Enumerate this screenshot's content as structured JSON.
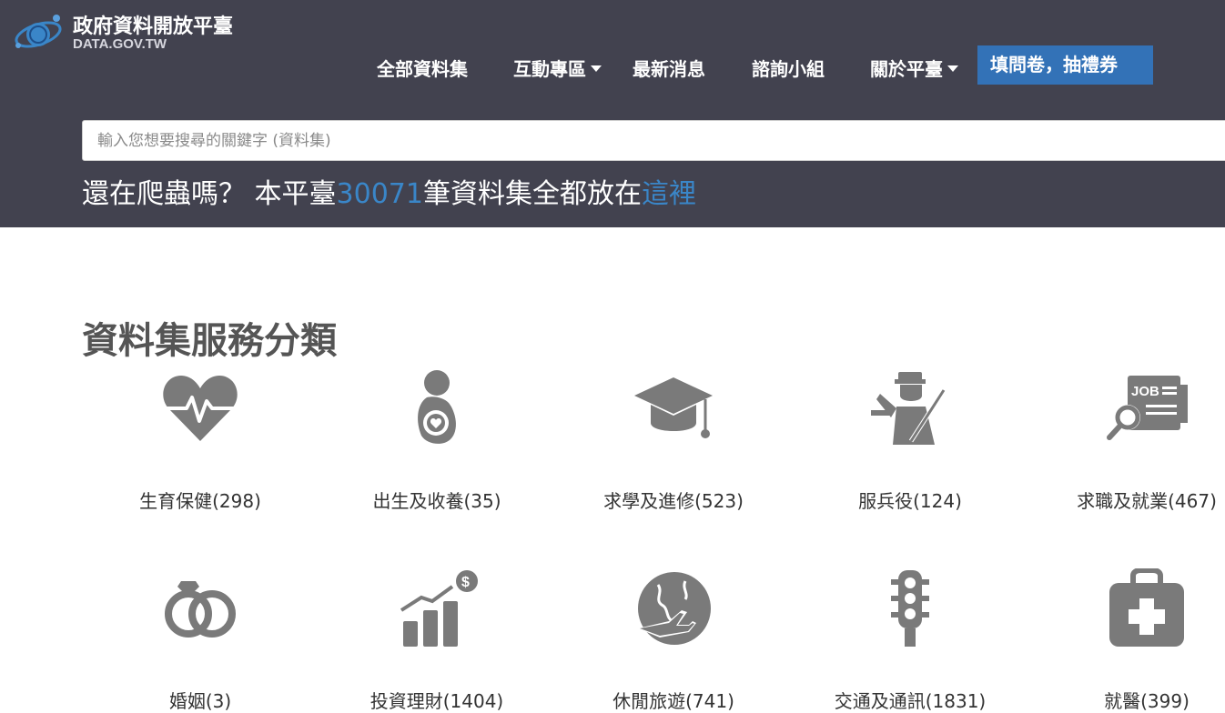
{
  "brand": {
    "title": "政府資料開放平臺",
    "subtitle": "DATA.GOV.TW"
  },
  "nav": {
    "items": [
      {
        "label": "全部資料集",
        "dropdown": false
      },
      {
        "label": "互動專區",
        "dropdown": true
      },
      {
        "label": "最新消息",
        "dropdown": false
      },
      {
        "label": "諮詢小組",
        "dropdown": false
      },
      {
        "label": "關於平臺",
        "dropdown": true
      }
    ],
    "cta_label": "填問卷，抽禮券"
  },
  "search": {
    "placeholder": "輸入您想要搜尋的關鍵字 (資料集)"
  },
  "tagline": {
    "prefix": "還在爬蟲嗎？ 本平臺",
    "count": "30071",
    "middle": "筆資料集全都放在",
    "link": "這裡"
  },
  "categories_section": {
    "title": "資料集服務分類",
    "items": [
      {
        "label": "生育保健(298)",
        "icon": "heart-pulse-icon"
      },
      {
        "label": "出生及收養(35)",
        "icon": "mother-baby-icon"
      },
      {
        "label": "求學及進修(523)",
        "icon": "graduation-cap-icon"
      },
      {
        "label": "服兵役(124)",
        "icon": "soldier-icon"
      },
      {
        "label": "求職及就業(467)",
        "icon": "job-search-icon"
      },
      {
        "label": "婚姻(3)",
        "icon": "wedding-rings-icon"
      },
      {
        "label": "投資理財(1404)",
        "icon": "investment-chart-icon"
      },
      {
        "label": "休閒旅遊(741)",
        "icon": "globe-plane-icon"
      },
      {
        "label": "交通及通訊(1831)",
        "icon": "traffic-light-icon"
      },
      {
        "label": "就醫(399)",
        "icon": "medical-kit-icon"
      }
    ]
  },
  "colors": {
    "header_bg": "#42424f",
    "accent": "#3372b7",
    "link": "#3a86c8",
    "icon": "#7a7a7a"
  }
}
